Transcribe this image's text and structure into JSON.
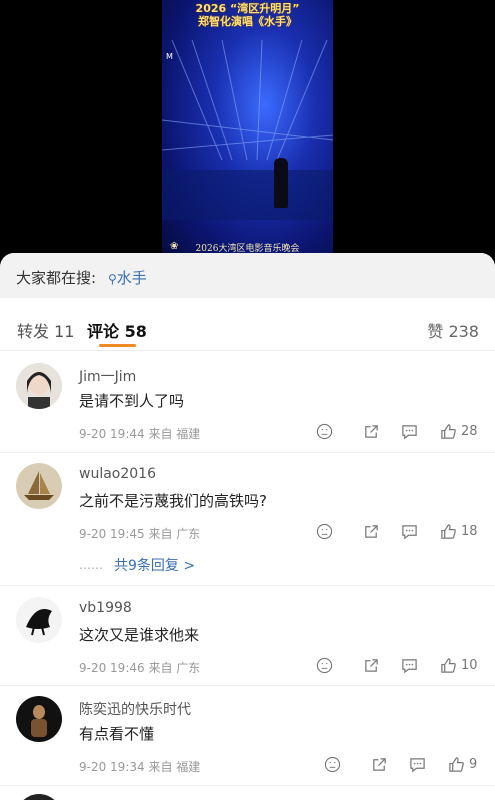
{
  "video": {
    "title_line1": "2026 “湾区升明月”",
    "title_line2": "郑智化演唱《水手》",
    "caption": "2026大湾区电影音乐晚会"
  },
  "search": {
    "label": "大家都在搜:",
    "term": "水手"
  },
  "tabs": {
    "repost": "转发 11",
    "comments": "评论 58",
    "likes": "赞 238"
  },
  "comments": [
    {
      "username": "Jim一Jim",
      "text": "是请不到人了吗",
      "meta": "9-20 19:44 来自 福建",
      "likes": "28"
    },
    {
      "username": "wulao2016",
      "text": "之前不是污蔑我们的高铁吗?",
      "meta": "9-20 19:45 来自 广东",
      "likes": "18",
      "replies": "共9条回复 >"
    },
    {
      "username": "vb1998",
      "text": "这次又是谁求他来",
      "meta": "9-20 19:46 来自 广东",
      "likes": "10"
    },
    {
      "username": "陈奕迅的快乐时代",
      "text": "有点看不懂",
      "meta": "9-20 19:34 来自 福建",
      "likes": "9"
    }
  ],
  "replies_dots": "……"
}
